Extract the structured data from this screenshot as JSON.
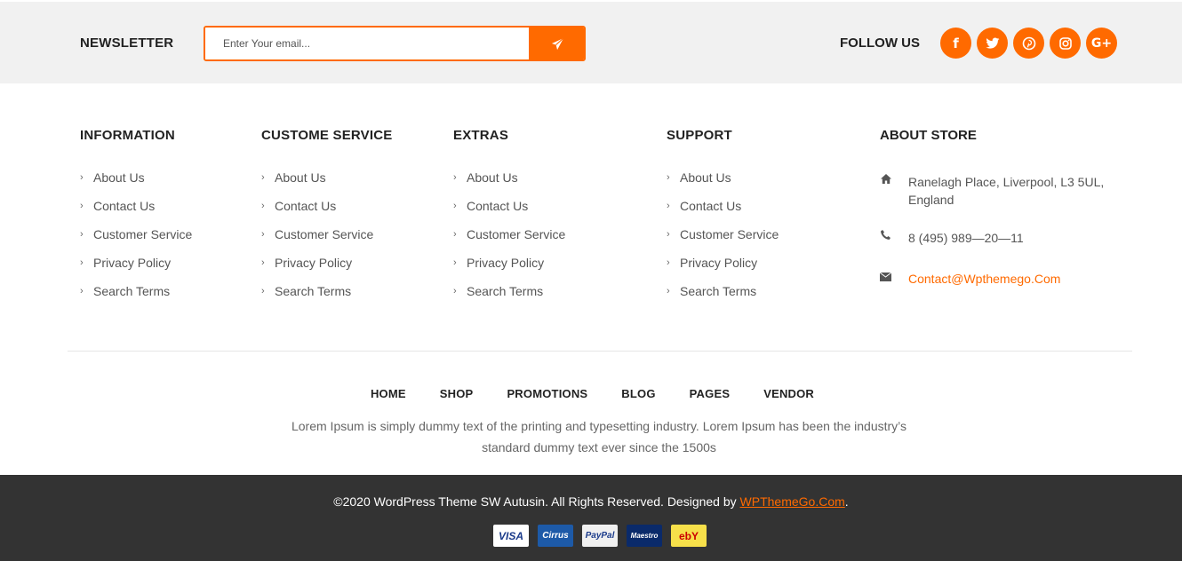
{
  "newsletter": {
    "label": "NEWSLETTER",
    "placeholder": "Enter Your email...",
    "submit_icon": "paper-plane-icon"
  },
  "follow": {
    "label": "FOLLOW US",
    "icons": [
      "facebook-icon",
      "twitter-icon",
      "pinterest-icon",
      "instagram-icon",
      "google-plus-icon"
    ]
  },
  "columns": [
    {
      "title": "INFORMATION",
      "links": [
        "About Us",
        "Contact Us",
        "Customer Service",
        "Privacy Policy",
        "Search Terms"
      ]
    },
    {
      "title": "CUSTOME SERVICE",
      "links": [
        "About Us",
        "Contact Us",
        "Customer Service",
        "Privacy Policy",
        "Search Terms"
      ]
    },
    {
      "title": "EXTRAS",
      "links": [
        "About Us",
        "Contact Us",
        "Customer Service",
        "Privacy Policy",
        "Search Terms"
      ]
    },
    {
      "title": "SUPPORT",
      "links": [
        "About Us",
        "Contact Us",
        "Customer Service",
        "Privacy Policy",
        "Search Terms"
      ]
    }
  ],
  "about": {
    "title": "ABOUT STORE",
    "address": "Ranelagh Place, Liverpool, L3 5UL, England",
    "phone": "8 (495) 989—20—11",
    "email": "Contact@Wpthemego.Com"
  },
  "bottom_nav": [
    "HOME",
    "SHOP",
    "PROMOTIONS",
    "BLOG",
    "PAGES",
    "VENDOR"
  ],
  "description": "Lorem Ipsum is simply dummy text of the printing and typesetting industry. Lorem Ipsum has been the industry’s standard dummy text ever since the 1500s",
  "footer": {
    "copyright_prefix": "©2020 WordPress Theme SW Autusin. All Rights Reserved. Designed by ",
    "designer_link": "WPThemeGo.Com",
    "copyright_suffix": ".",
    "payments": [
      "VISA",
      "Cirrus",
      "PayPal",
      "Maestro",
      "ebY"
    ]
  },
  "colors": {
    "accent": "#ff6a00",
    "footer_bg": "#333333",
    "newsletter_bg": "#f1f1f1"
  }
}
